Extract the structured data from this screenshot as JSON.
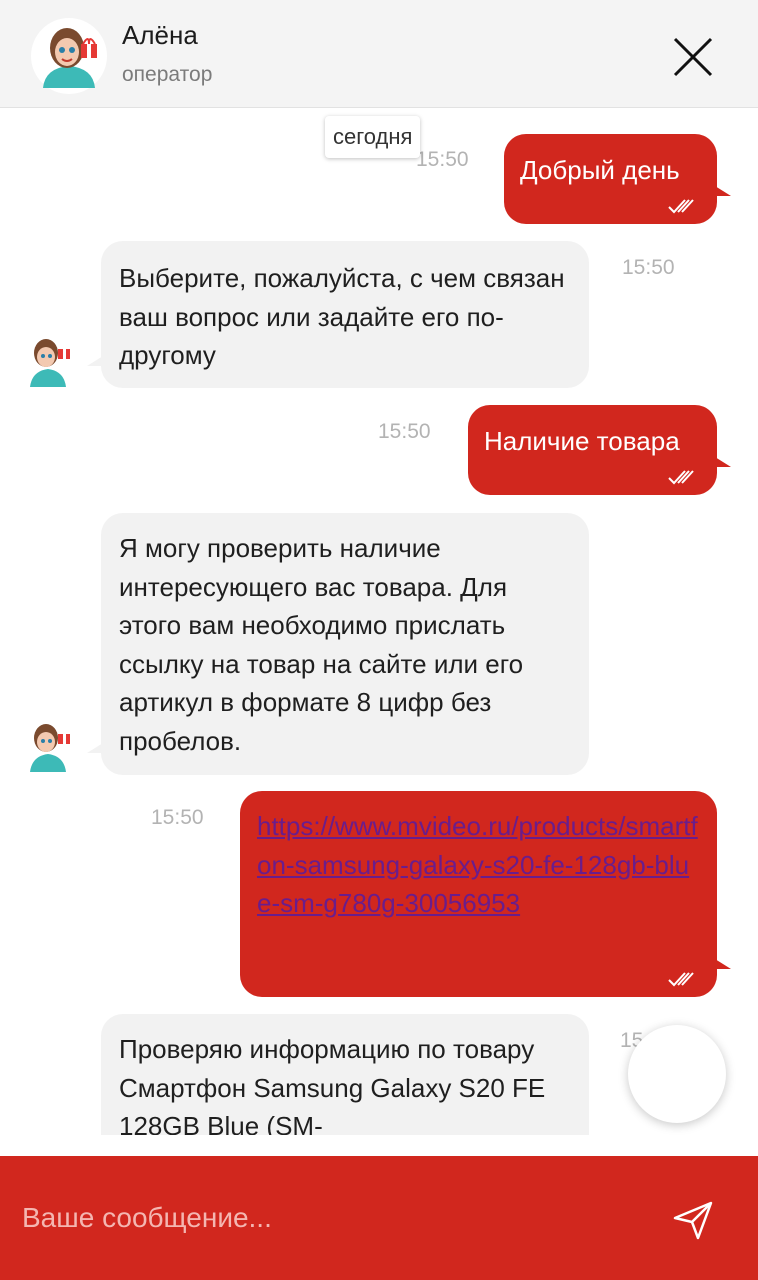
{
  "header": {
    "operator_name": "Алёна",
    "operator_role": "оператор",
    "avatar_icon": "operator-avatar-girl-with-gift",
    "close_icon": "close-icon"
  },
  "chat": {
    "date_separator": "сегодня",
    "messages": [
      {
        "direction": "outgoing",
        "text": "Добрый день",
        "time": "15:50",
        "status": "read"
      },
      {
        "direction": "incoming",
        "text": "Выберите, пожалуйста, с чем связан ваш вопрос или задайте его по-другому",
        "time": "15:50"
      },
      {
        "direction": "outgoing",
        "text": "Наличие товара",
        "time": "15:50",
        "status": "read"
      },
      {
        "direction": "incoming",
        "text": "Я могу проверить наличие интересующего вас товара. Для этого вам необходимо прислать ссылку на товар на сайте или его артикул в формате 8 цифр без пробелов.",
        "time": ""
      },
      {
        "direction": "outgoing",
        "text": "https://www.mvideo.ru/products/smartfon-samsung-galaxy-s20-fe-128gb-blue-sm-g780g-30056953",
        "time": "15:50",
        "status": "read",
        "is_link": true
      },
      {
        "direction": "incoming",
        "text": "Проверяю информацию по товару Смартфон Samsung Galaxy S20 FE 128GB Blue (SM-",
        "time": "15"
      }
    ]
  },
  "composer": {
    "placeholder": "Ваше сообщение...",
    "send_icon": "send-icon"
  },
  "colors": {
    "brand_red": "#d1271e",
    "incoming_bubble": "#f2f2f2",
    "header_bg": "#f4f4f4",
    "link": "#6a1d8c"
  }
}
